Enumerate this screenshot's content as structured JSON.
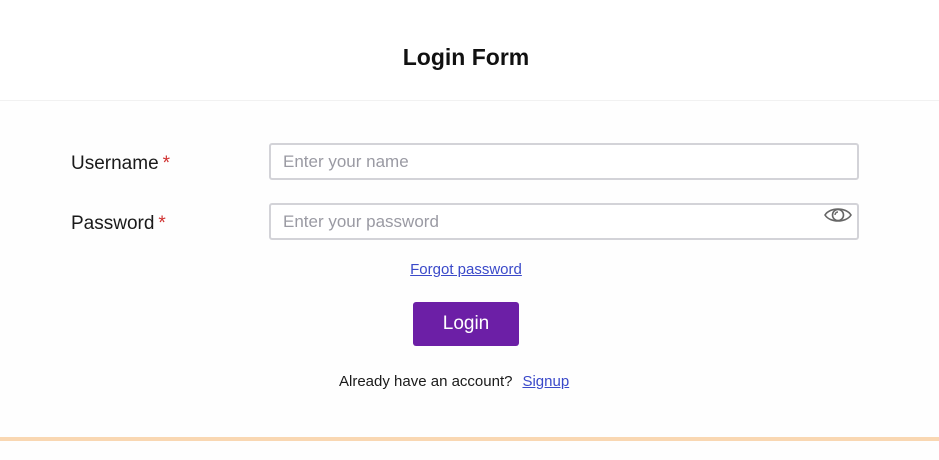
{
  "header": {
    "title": "Login Form"
  },
  "form": {
    "username": {
      "label": "Username",
      "required_mark": "*",
      "placeholder": "Enter your name",
      "value": ""
    },
    "password": {
      "label": "Password",
      "required_mark": "*",
      "placeholder": "Enter your password",
      "value": "",
      "toggle_icon": "eye-icon"
    },
    "forgot_link": "Forgot password",
    "login_button": "Login",
    "signup_prompt": "Already have an account?",
    "signup_link": "Signup"
  },
  "colors": {
    "primary_button": "#6c1fa6",
    "link": "#3a49c9",
    "required": "#d0302f",
    "accent_line": "#f9d7b2"
  }
}
